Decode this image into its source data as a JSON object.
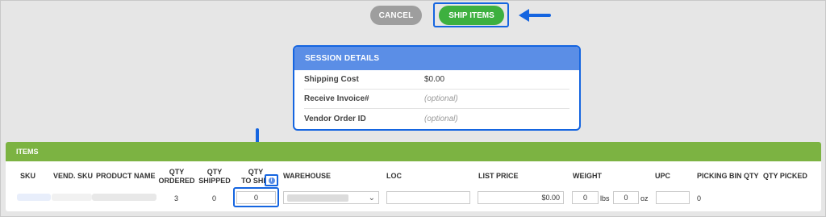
{
  "toolbar": {
    "cancel_label": "CANCEL",
    "ship_label": "SHIP ITEMS"
  },
  "session": {
    "title": "SESSION DETAILS",
    "rows": [
      {
        "label": "Shipping Cost",
        "value": "$0.00",
        "optional": false
      },
      {
        "label": "Receive Invoice#",
        "value": "(optional)",
        "optional": true
      },
      {
        "label": "Vendor Order ID",
        "value": "(optional)",
        "optional": true
      }
    ]
  },
  "items": {
    "title": "ITEMS",
    "columns": {
      "sku": "SKU",
      "vend_sku": "VEND. SKU",
      "product_name": "PRODUCT NAME",
      "qty_ordered_1": "QTY",
      "qty_ordered_2": "ORDERED",
      "qty_shipped_1": "QTY",
      "qty_shipped_2": "SHIPPED",
      "qty_to_ship_1": "QTY",
      "qty_to_ship_2": "TO SHIP",
      "warehouse": "WAREHOUSE",
      "loc": "LOC",
      "list_price": "LIST PRICE",
      "weight": "WEIGHT",
      "upc": "UPC",
      "picking_bin_qty": "PICKING BIN QTY",
      "qty_picked": "QTY PICKED"
    },
    "row": {
      "qty_ordered": "3",
      "qty_shipped": "0",
      "qty_to_ship": "0",
      "list_price": "$0.00",
      "weight_lbs": "0",
      "lbs_unit": "lbs",
      "weight_oz": "0",
      "oz_unit": "oz",
      "picking_bin_qty": "0"
    },
    "info_icon": "i"
  },
  "colors": {
    "accent_blue": "#1565e0",
    "ship_green": "#3db03f",
    "items_header_green": "#7cb342",
    "session_header_blue": "#5b8ee6"
  }
}
